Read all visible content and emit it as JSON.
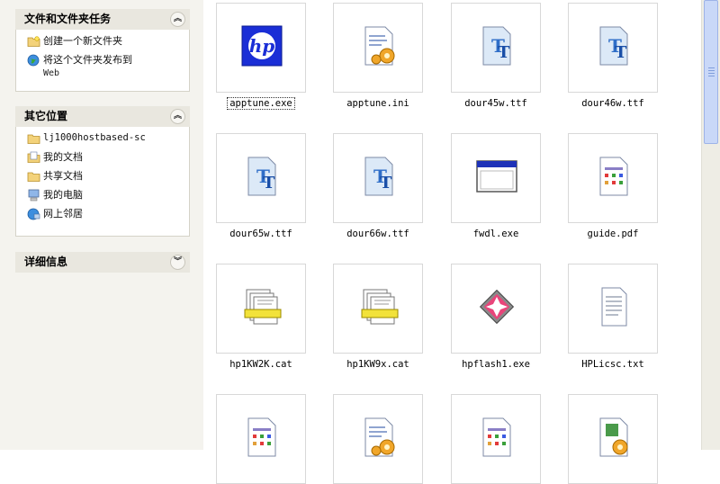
{
  "sidebar": {
    "tasks_section": {
      "title": "文件和文件夹任务",
      "items": [
        {
          "label": "创建一个新文件夹",
          "icon": "new-folder-icon"
        },
        {
          "label": "将这个文件夹发布到",
          "label2": "Web",
          "icon": "publish-web-icon"
        }
      ]
    },
    "places_section": {
      "title": "其它位置",
      "items": [
        {
          "label": "lj1000hostbased-sc",
          "icon": "folder-icon"
        },
        {
          "label": "我的文档",
          "icon": "my-documents-icon"
        },
        {
          "label": "共享文档",
          "icon": "shared-folder-icon"
        },
        {
          "label": "我的电脑",
          "icon": "my-computer-icon"
        },
        {
          "label": "网上邻居",
          "icon": "network-places-icon"
        }
      ]
    },
    "details_section": {
      "title": "详细信息"
    }
  },
  "files": [
    {
      "name": "apptune.exe",
      "icon": "hp-logo-icon"
    },
    {
      "name": "apptune.ini",
      "icon": "config-file-icon"
    },
    {
      "name": "dour45w.ttf",
      "icon": "truetype-font-icon"
    },
    {
      "name": "dour46w.ttf",
      "icon": "truetype-font-icon"
    },
    {
      "name": "dour65w.ttf",
      "icon": "truetype-font-icon"
    },
    {
      "name": "dour66w.ttf",
      "icon": "truetype-font-icon"
    },
    {
      "name": "fwdl.exe",
      "icon": "application-window-icon"
    },
    {
      "name": "guide.pdf",
      "icon": "pdf-file-icon"
    },
    {
      "name": "hp1KW2K.cat",
      "icon": "security-catalog-icon"
    },
    {
      "name": "hp1KW9x.cat",
      "icon": "security-catalog-icon"
    },
    {
      "name": "hpflash1.exe",
      "icon": "flash-app-icon"
    },
    {
      "name": "HPLicsc.txt",
      "icon": "text-file-icon"
    },
    {
      "name": "",
      "icon": "pdf-file-icon"
    },
    {
      "name": "",
      "icon": "config-file-icon"
    },
    {
      "name": "",
      "icon": "pdf-file-icon"
    },
    {
      "name": "",
      "icon": "setup-file-icon"
    }
  ],
  "selected_file": "apptune.exe"
}
